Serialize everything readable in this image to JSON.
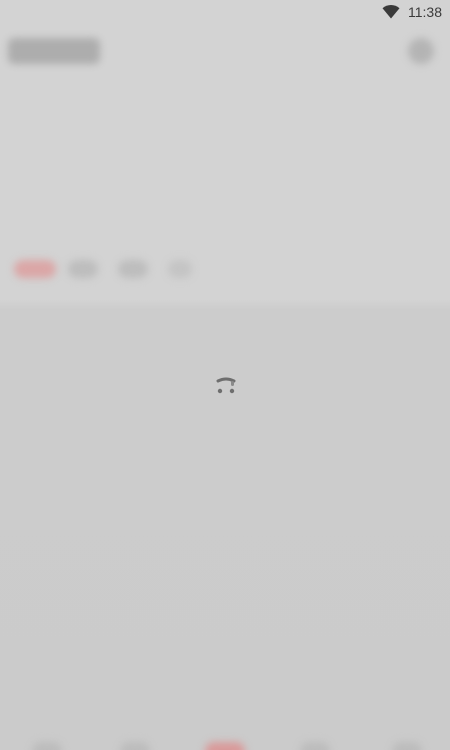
{
  "status_bar": {
    "time": "11:38",
    "wifi_icon": "wifi-icon"
  },
  "colors": {
    "background": "#d3d3d3",
    "spinner": "#707070",
    "accent_blurred": "#d99a9a"
  },
  "loading": {
    "icon": "loading-spinner-icon"
  }
}
